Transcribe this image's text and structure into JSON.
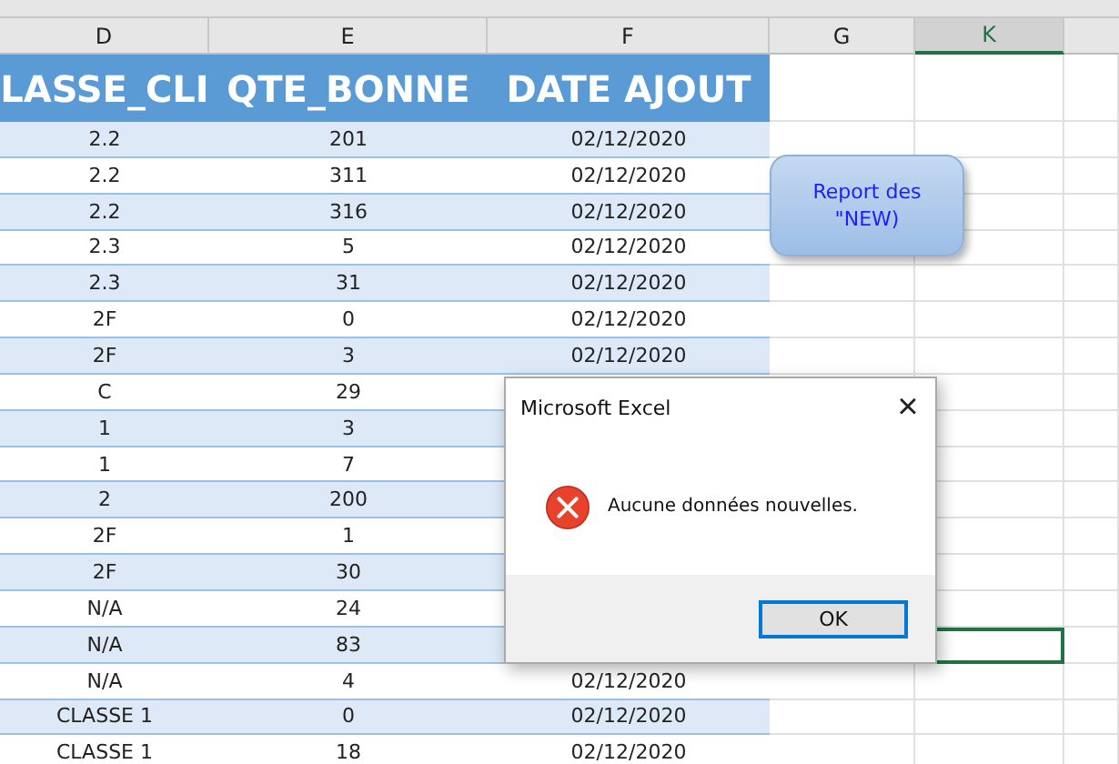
{
  "columns": [
    {
      "letter": "D",
      "selected": false
    },
    {
      "letter": "E",
      "selected": false
    },
    {
      "letter": "F",
      "selected": false
    },
    {
      "letter": "G",
      "selected": false
    },
    {
      "letter": "K",
      "selected": true
    }
  ],
  "table": {
    "headers": [
      "LASSE_CLI",
      "QTE_BONNE",
      "DATE AJOUT"
    ],
    "rows": [
      {
        "classe": "2.2",
        "qte": "201",
        "date": "02/12/2020",
        "k_selected": false
      },
      {
        "classe": "2.2",
        "qte": "311",
        "date": "02/12/2020",
        "k_selected": false
      },
      {
        "classe": "2.2",
        "qte": "316",
        "date": "02/12/2020",
        "k_selected": false
      },
      {
        "classe": "2.3",
        "qte": "5",
        "date": "02/12/2020",
        "k_selected": false
      },
      {
        "classe": "2.3",
        "qte": "31",
        "date": "02/12/2020",
        "k_selected": false
      },
      {
        "classe": "2F",
        "qte": "0",
        "date": "02/12/2020",
        "k_selected": false
      },
      {
        "classe": "2F",
        "qte": "3",
        "date": "02/12/2020",
        "k_selected": false
      },
      {
        "classe": "C",
        "qte": "29",
        "k_selected": false
      },
      {
        "classe": "1",
        "qte": "3",
        "k_selected": false
      },
      {
        "classe": "1",
        "qte": "7",
        "k_selected": false
      },
      {
        "classe": "2",
        "qte": "200",
        "k_selected": false
      },
      {
        "classe": "2F",
        "qte": "1",
        "k_selected": false
      },
      {
        "classe": "2F",
        "qte": "30",
        "k_selected": false
      },
      {
        "classe": "N/A",
        "qte": "24",
        "k_selected": false
      },
      {
        "classe": "N/A",
        "qte": "83",
        "k_selected": true
      },
      {
        "classe": "N/A",
        "qte": "4",
        "date": "02/12/2020",
        "k_selected": false
      },
      {
        "classe": "CLASSE 1",
        "qte": "0",
        "date": "02/12/2020",
        "k_selected": false
      },
      {
        "classe": "CLASSE 1",
        "qte": "18",
        "date": "02/12/2020",
        "k_selected": false
      }
    ]
  },
  "shape_button": {
    "label": "Report des \"NEW)"
  },
  "dialog": {
    "title": "Microsoft Excel",
    "close": "×",
    "message": "Aucune données nouvelles.",
    "buttons": [
      "OK"
    ]
  }
}
